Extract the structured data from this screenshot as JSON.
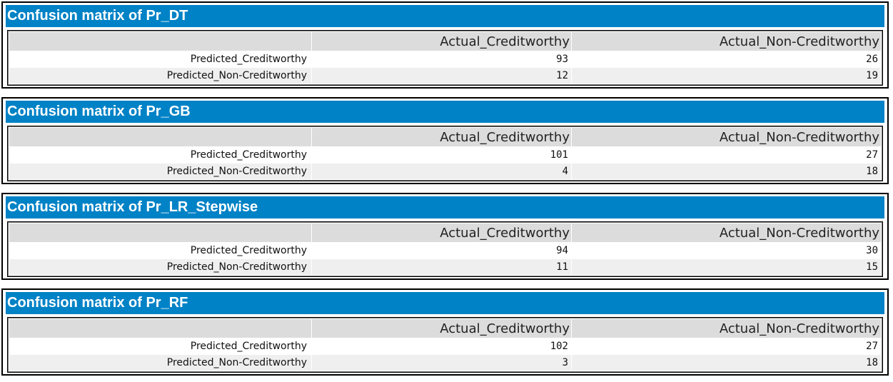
{
  "matrices": [
    {
      "title": "Confusion matrix of Pr_DT",
      "col_headers": [
        "Actual_Creditworthy",
        "Actual_Non-Creditworthy"
      ],
      "rows": [
        {
          "label": "Predicted_Creditworthy",
          "values": [
            "93",
            "26"
          ]
        },
        {
          "label": "Predicted_Non-Creditworthy",
          "values": [
            "12",
            "19"
          ]
        }
      ]
    },
    {
      "title": "Confusion matrix of Pr_GB",
      "col_headers": [
        "Actual_Creditworthy",
        "Actual_Non-Creditworthy"
      ],
      "rows": [
        {
          "label": "Predicted_Creditworthy",
          "values": [
            "101",
            "27"
          ]
        },
        {
          "label": "Predicted_Non-Creditworthy",
          "values": [
            "4",
            "18"
          ]
        }
      ]
    },
    {
      "title": "Confusion matrix of Pr_LR_Stepwise",
      "col_headers": [
        "Actual_Creditworthy",
        "Actual_Non-Creditworthy"
      ],
      "rows": [
        {
          "label": "Predicted_Creditworthy",
          "values": [
            "94",
            "30"
          ]
        },
        {
          "label": "Predicted_Non-Creditworthy",
          "values": [
            "11",
            "15"
          ]
        }
      ]
    },
    {
      "title": "Confusion matrix of Pr_RF",
      "col_headers": [
        "Actual_Creditworthy",
        "Actual_Non-Creditworthy"
      ],
      "rows": [
        {
          "label": "Predicted_Creditworthy",
          "values": [
            "102",
            "27"
          ]
        },
        {
          "label": "Predicted_Non-Creditworthy",
          "values": [
            "3",
            "18"
          ]
        }
      ]
    }
  ],
  "colors": {
    "title_bar": "#0082c6",
    "header_row": "#dcdcdc",
    "alt_row": "#efefef"
  }
}
